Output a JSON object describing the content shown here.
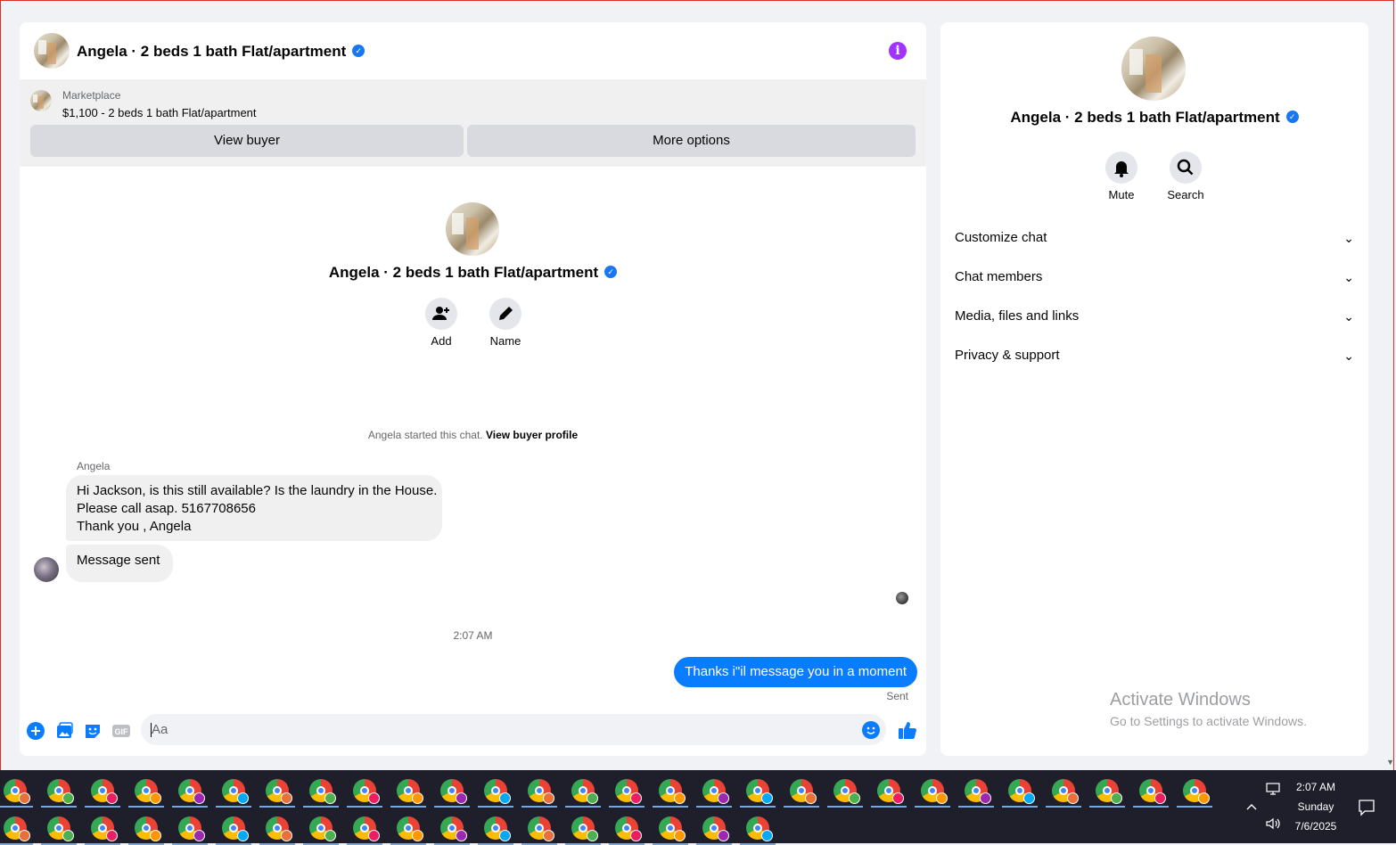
{
  "chat": {
    "title": "Angela · 2 beds 1 bath Flat/apartment",
    "marketplace_label": "Marketplace",
    "listing": "$1,100 - 2 beds 1 bath Flat/apartment",
    "view_buyer_label": "View buyer",
    "more_options_label": "More options",
    "intro_title": "Angela · 2 beds 1 bath Flat/apartment",
    "add_label": "Add",
    "name_label": "Name",
    "started_text": "Angela started this chat.",
    "view_buyer_profile": "View buyer profile",
    "sender_name": "Angela",
    "messages_in": [
      "Hi Jackson, is this still available? Is the laundry in the House.",
      "Please call asap. 5167708656",
      "Thank you , Angela"
    ],
    "message_sent": "Message sent",
    "timestamp": "2:07 AM",
    "message_out": "Thanks i\"il message you in a moment",
    "sent_status": "Sent",
    "composer_placeholder": "Aa",
    "gif_label": "GIF"
  },
  "details": {
    "title": "Angela · 2 beds 1 bath Flat/apartment",
    "mute_label": "Mute",
    "search_label": "Search",
    "sections": [
      "Customize chat",
      "Chat members",
      "Media, files and links",
      "Privacy & support"
    ],
    "watermark_line1": "Activate Windows",
    "watermark_line2": "Go to Settings to activate Windows."
  },
  "taskbar": {
    "time": "2:07 AM",
    "day": "Sunday",
    "date": "7/6/2025",
    "row1_count": 28,
    "row2_count": 18,
    "profile_badge_colors": [
      "#e8703a",
      "#4caf50",
      "#e91e63",
      "#ff9800",
      "#9c27b0",
      "#03a9f4"
    ]
  },
  "colors": {
    "accent": "#0a7cff",
    "info": "#a033ff",
    "verified": "#1877f2"
  }
}
